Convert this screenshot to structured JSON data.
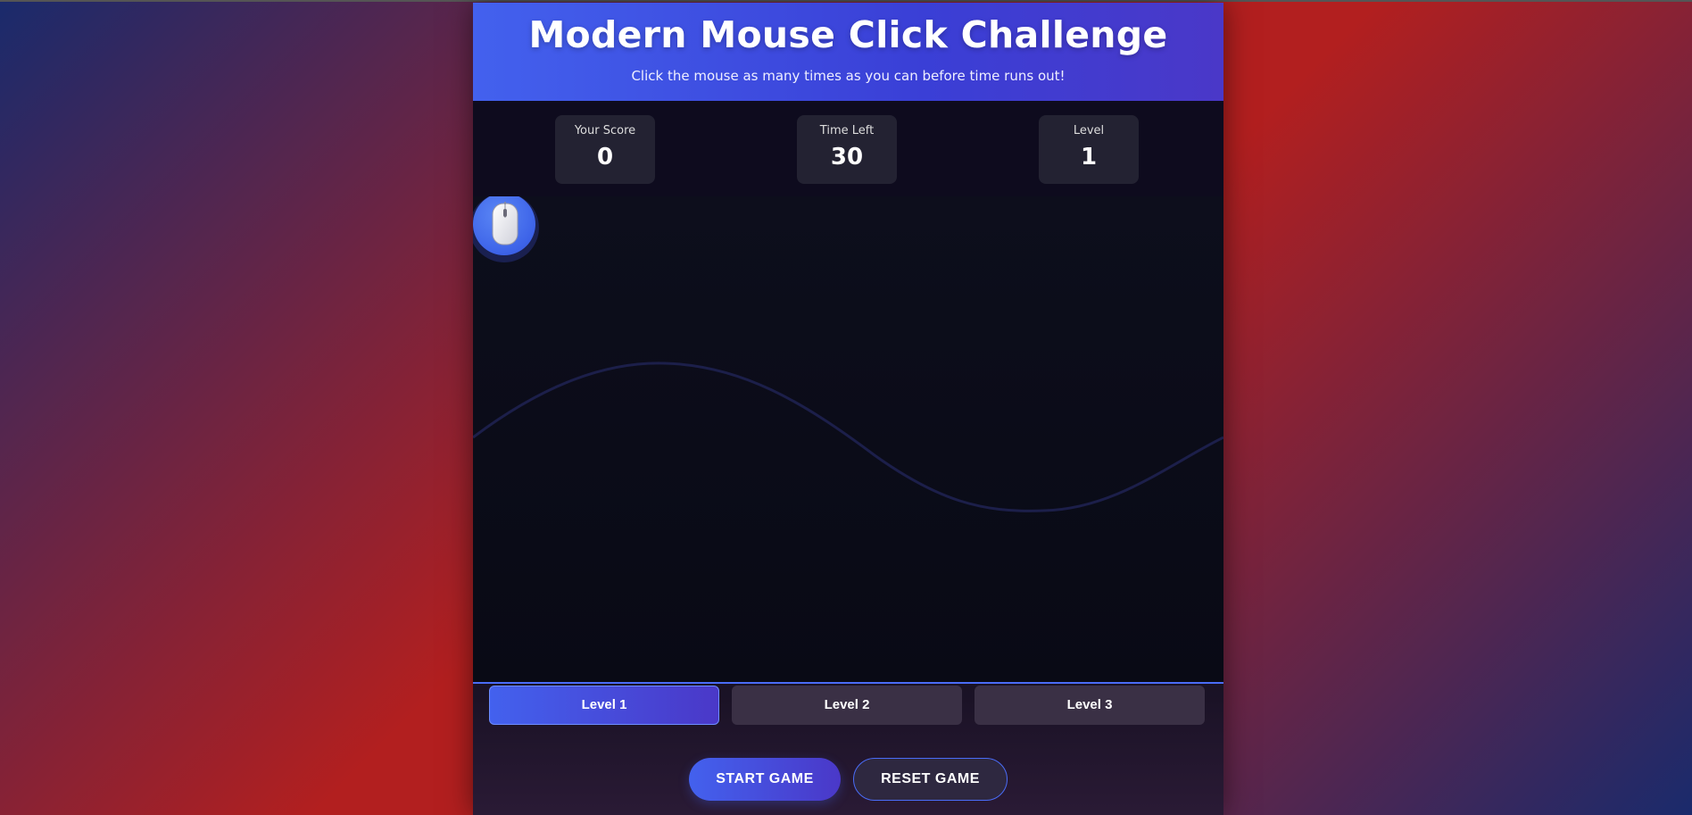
{
  "header": {
    "title": "Modern Mouse Click Challenge",
    "subtitle": "Click the mouse as many times as you can before time runs out!"
  },
  "stats": {
    "score_label": "Your Score",
    "score_value": "0",
    "time_label": "Time Left",
    "time_value": "30",
    "level_label": "Level",
    "level_value": "1"
  },
  "target": {
    "icon": "computer-mouse-icon"
  },
  "levels": [
    {
      "label": "Level 1",
      "active": true
    },
    {
      "label": "Level 2",
      "active": false
    },
    {
      "label": "Level 3",
      "active": false
    }
  ],
  "controls": {
    "start_label": "START GAME",
    "reset_label": "RESET GAME"
  },
  "colors": {
    "accent": "#4361ee",
    "accent_secondary": "#4a38c8",
    "background_red": "#b21f1f",
    "background_blue": "#1a2a6c"
  }
}
